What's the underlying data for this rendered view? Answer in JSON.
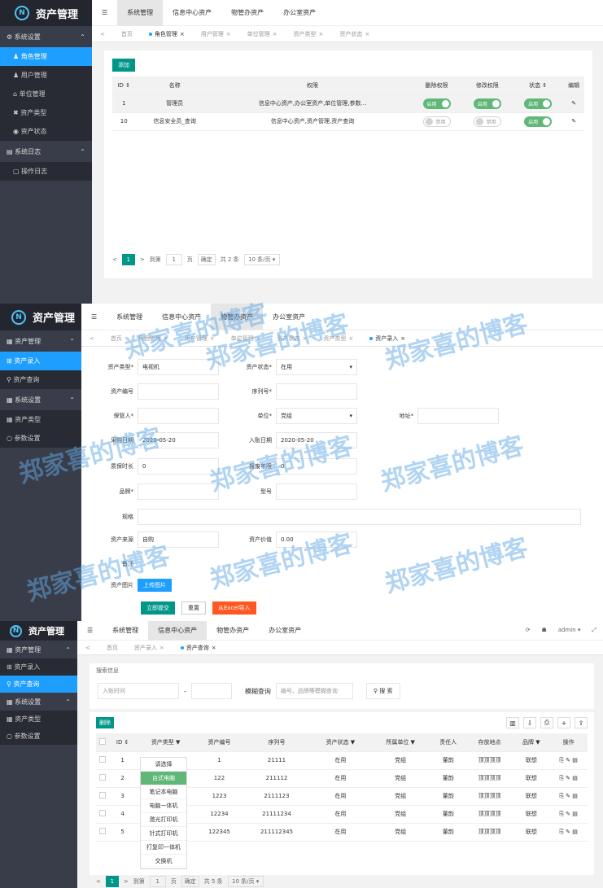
{
  "app": {
    "logo_text": "资产管理",
    "logo_icon": "N"
  },
  "p1": {
    "top_tabs": [
      "☰",
      "系统管理",
      "信息中心资产",
      "物管办资产",
      "办公室资产"
    ],
    "page_tabs": [
      "首页",
      "角色管理",
      "用户管理",
      "单位管理",
      "资产类型",
      "资产状态"
    ],
    "sidebar": {
      "group1": "系统设置",
      "items": [
        "角色管理",
        "用户管理",
        "单位管理",
        "资产类型",
        "资产状态"
      ],
      "group2": "系统日志",
      "log_item": "操作日志"
    },
    "add_btn": "添加",
    "headers": [
      "ID ⇕",
      "名称",
      "权限",
      "删除权限",
      "修改权限",
      "状态 ⇕",
      "编辑"
    ],
    "rows": [
      {
        "id": "1",
        "name": "管理员",
        "perm": "信息中心资产,办公室资产,单位管理,参数...",
        "s1": "启用",
        "s2": "启用",
        "s3": "启用"
      },
      {
        "id": "10",
        "name": "信息安全员_查询",
        "perm": "信息中心资产,资产管理,资产查询",
        "s1": "禁用",
        "s2": "禁用",
        "s3": "启用"
      }
    ],
    "pager": {
      "cur": "1",
      "goto": "到第",
      "page_input": "1",
      "page": "页",
      "ok": "确定",
      "total": "共 2 条",
      "per": "10 条/页 ▾"
    }
  },
  "p2": {
    "top_tabs": [
      "☰",
      "系统管理",
      "信息中心资产",
      "物管办资产",
      "办公室资产"
    ],
    "page_tabs": [
      "首页",
      "角色管理",
      "用户管理",
      "单位管理",
      "资产状态",
      "资产类型",
      "资产录入"
    ],
    "sidebar": {
      "group1": "资产管理",
      "items": [
        "资产录入",
        "资产查询"
      ],
      "group2": "系统设置",
      "items2": [
        "资产类型",
        "参数设置"
      ]
    },
    "form": {
      "type_lbl": "资产类型*",
      "type_val": "电视机",
      "status_lbl": "资产状态*",
      "status_val": "在用",
      "code_lbl": "资产编号",
      "serial_lbl": "序列号*",
      "keeper_lbl": "保管人*",
      "unit_lbl": "单位*",
      "unit_val": "党组",
      "addr_lbl": "地址*",
      "buy_lbl": "采购日期",
      "buy_val": "2020-05-20",
      "in_lbl": "入账日期",
      "in_val": "2020-05-20",
      "warr_lbl": "质保时长",
      "warr_val": "0",
      "scrap_lbl": "报废年限",
      "scrap_val": "0",
      "brand_lbl": "品牌*",
      "model_lbl": "型号",
      "spec_lbl": "规格",
      "src_lbl": "资产来源",
      "src_val": "自购",
      "value_lbl": "资产价值",
      "value_val": "0.00",
      "note_lbl": "备注",
      "img_lbl": "资产图片",
      "upload": "上传图片",
      "submit": "立即提交",
      "reset": "重置",
      "excel": "从Excel导入"
    }
  },
  "p3": {
    "top_tabs": [
      "☰",
      "系统管理",
      "信息中心资产",
      "物管办资产",
      "办公室资产"
    ],
    "top_right": [
      "⟳",
      "☗",
      "admin ▾",
      "⤢"
    ],
    "page_tabs": [
      "首页",
      "资产录入",
      "资产查询"
    ],
    "sidebar": {
      "group1": "资产管理",
      "items": [
        "资产录入",
        "资产查询"
      ],
      "group2": "系统设置",
      "items2": [
        "资产类型",
        "参数设置"
      ]
    },
    "search": {
      "title": "搜索信息",
      "date_ph": "入账时间",
      "dash": "-",
      "fuzzy": "模糊查询",
      "fuzzy_ph": "编号、品牌等模糊查询",
      "btn": "搜 索"
    },
    "del_btn": "删除",
    "headers": [
      "",
      "ID ⇕",
      "资产类型 ▼",
      "资产编号",
      "序列号",
      "资产状态 ▼",
      "所属单位 ▼",
      "责任人",
      "存放地点",
      "品牌 ▼",
      "操作"
    ],
    "rows": [
      [
        "",
        "1",
        "请选择",
        "1",
        "21111",
        "在用",
        "党组",
        "董韵",
        "顶顶顶顶",
        "联想",
        "⎘ ✎ ▤"
      ],
      [
        "",
        "2",
        "",
        "122",
        "211112",
        "在用",
        "党组",
        "董韵",
        "顶顶顶顶",
        "联想",
        "⎘ ✎ ▤"
      ],
      [
        "",
        "3",
        "",
        "1223",
        "2111123",
        "在用",
        "党组",
        "董韵",
        "顶顶顶顶",
        "联想",
        "⎘ ✎ ▤"
      ],
      [
        "",
        "4",
        "",
        "12234",
        "21111234",
        "在用",
        "党组",
        "董韵",
        "顶顶顶顶",
        "联想",
        "⎘ ✎ ▤"
      ],
      [
        "",
        "5",
        "",
        "122345",
        "211112345",
        "在用",
        "党组",
        "董韵",
        "顶顶顶顶",
        "联想",
        "⎘ ✎ ▤"
      ]
    ],
    "dropdown": [
      "请选择",
      "台式电脑",
      "笔记本电脑",
      "电脑一体机",
      "激光打印机",
      "针式打印机",
      "打复印一体机",
      "交换机"
    ],
    "pager": {
      "cur": "1",
      "goto": "到第",
      "page_input": "1",
      "page": "页",
      "ok": "确定",
      "total": "共 5 条",
      "per": "10 条/页 ▾"
    }
  },
  "watermark": "郑家喜的博客"
}
